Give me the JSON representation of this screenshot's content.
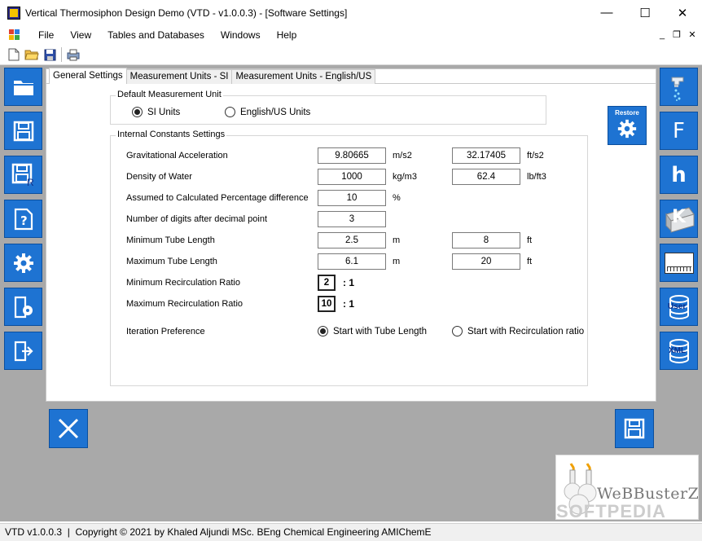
{
  "window": {
    "title": "Vertical Thermosiphon Design Demo (VTD - v1.0.0.3) - [Software Settings]",
    "minimize": "—",
    "maximize": "☐",
    "close": "✕"
  },
  "menu": {
    "items": [
      "File",
      "View",
      "Tables and Databases",
      "Windows",
      "Help"
    ],
    "mdi_minimize": "_",
    "mdi_restore": "❐",
    "mdi_close": "✕"
  },
  "toolbar": {
    "icons": [
      "new-file-icon",
      "open-folder-icon",
      "save-disk-icon",
      "print-icon"
    ]
  },
  "left_sidebar": {
    "icons": [
      "open-folder-icon",
      "save-icon",
      "save-as-report-icon",
      "help-icon",
      "settings-gear-icon",
      "documentation-icon",
      "exit-icon"
    ],
    "save_as_letter": "R"
  },
  "right_sidebar": {
    "icons": [
      "water-tap-icon",
      "f-factor-icon",
      "h-coefficient-icon",
      "k-conductivity-icon",
      "units-icon",
      "user-database-icon",
      "xml-database-icon"
    ],
    "f_letter": "F",
    "h_letter": "h",
    "k_letter": "K",
    "units_label": "Units",
    "user_label": "User",
    "xml_label": "XML"
  },
  "tabs": [
    "General Settings",
    "Measurement Units - SI",
    "Measurement Units - English/US"
  ],
  "default_unit_group": {
    "legend": "Default Measurement Unit",
    "options": [
      "SI Units",
      "English/US Units"
    ],
    "selected": "SI Units"
  },
  "constants_group": {
    "legend": "Internal Constants Settings",
    "rows": [
      {
        "label": "Gravitational Acceleration",
        "si_value": "9.80665",
        "si_unit": "m/s2",
        "us_value": "32.17405",
        "us_unit": "ft/s2"
      },
      {
        "label": "Density of Water",
        "si_value": "1000",
        "si_unit": "kg/m3",
        "us_value": "62.4",
        "us_unit": "lb/ft3"
      },
      {
        "label": "Assumed to Calculated Percentage difference",
        "si_value": "10",
        "si_unit": "%"
      },
      {
        "label": "Number of digits after decimal point",
        "si_value": "3"
      },
      {
        "label": "Minimum Tube Length",
        "si_value": "2.5",
        "si_unit": "m",
        "us_value": "8",
        "us_unit": "ft"
      },
      {
        "label": "Maximum Tube Length",
        "si_value": "6.1",
        "si_unit": "m",
        "us_value": "20",
        "us_unit": "ft"
      },
      {
        "label": "Minimum Recirculation Ratio",
        "si_value": "2",
        "ratio_suffix": ": 1"
      },
      {
        "label": "Maximum Recirculation Ratio",
        "si_value": "10",
        "ratio_suffix": ": 1"
      }
    ],
    "iteration": {
      "label": "Iteration Preference",
      "options": [
        "Start with Tube Length",
        "Start with Recirculation ratio"
      ],
      "selected": "Start with Tube Length"
    }
  },
  "restore_button": {
    "label": "Restore"
  },
  "cancel_button": {
    "icon": "close-x-icon"
  },
  "save_button": {
    "icon": "save-disk-icon"
  },
  "watermark": {
    "text": "WeBBusterZ",
    "sub": "SOFTPEDIA"
  },
  "status": {
    "text": "VTD v1.0.0.3  |  Copyright © 2021 by Khaled Aljundi MSc. BEng Chemical Engineering AMIChemE"
  },
  "colors": {
    "accent_blue": "#1e73d2",
    "mdi_background": "#a9a9a9"
  }
}
